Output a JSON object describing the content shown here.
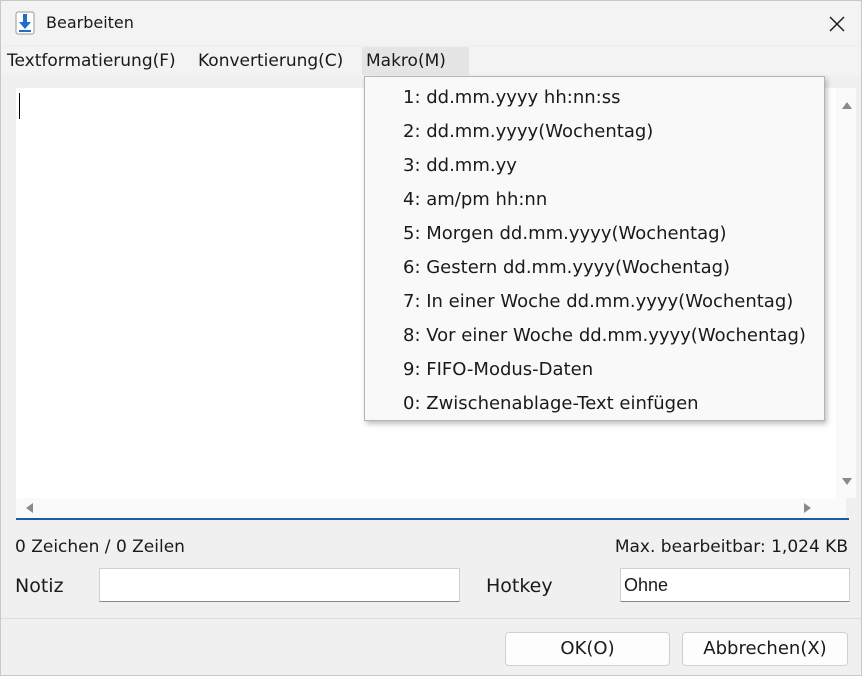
{
  "window": {
    "title": "Bearbeiten",
    "icon": "download-arrow-icon",
    "accent_color": "#1e5a9e"
  },
  "menubar": {
    "items": [
      {
        "label": "Textformatierung(F)"
      },
      {
        "label": "Konvertierung(C)"
      },
      {
        "label": "Makro(M)"
      }
    ]
  },
  "macro_menu": {
    "items": [
      {
        "label": "1: dd.mm.yyyy hh:nn:ss"
      },
      {
        "label": "2: dd.mm.yyyy(Wochentag)"
      },
      {
        "label": "3: dd.mm.yy"
      },
      {
        "label": "4: am/pm hh:nn"
      },
      {
        "label": "5: Morgen dd.mm.yyyy(Wochentag)"
      },
      {
        "label": "6: Gestern dd.mm.yyyy(Wochentag)"
      },
      {
        "label": "7: In einer Woche dd.mm.yyyy(Wochentag)"
      },
      {
        "label": "8: Vor einer Woche dd.mm.yyyy(Wochentag)"
      },
      {
        "label": "9: FIFO-Modus-Daten"
      },
      {
        "label": "0: Zwischenablage-Text einfügen"
      }
    ]
  },
  "editor": {
    "value": ""
  },
  "status": {
    "counts": "0 Zeichen / 0 Zeilen",
    "max_size": "Max. bearbeitbar: 1,024 KB"
  },
  "form": {
    "note_label": "Notiz",
    "note_value": "",
    "hotkey_label": "Hotkey",
    "hotkey_value": "Ohne"
  },
  "buttons": {
    "ok": "OK(O)",
    "cancel": "Abbrechen(X)"
  }
}
